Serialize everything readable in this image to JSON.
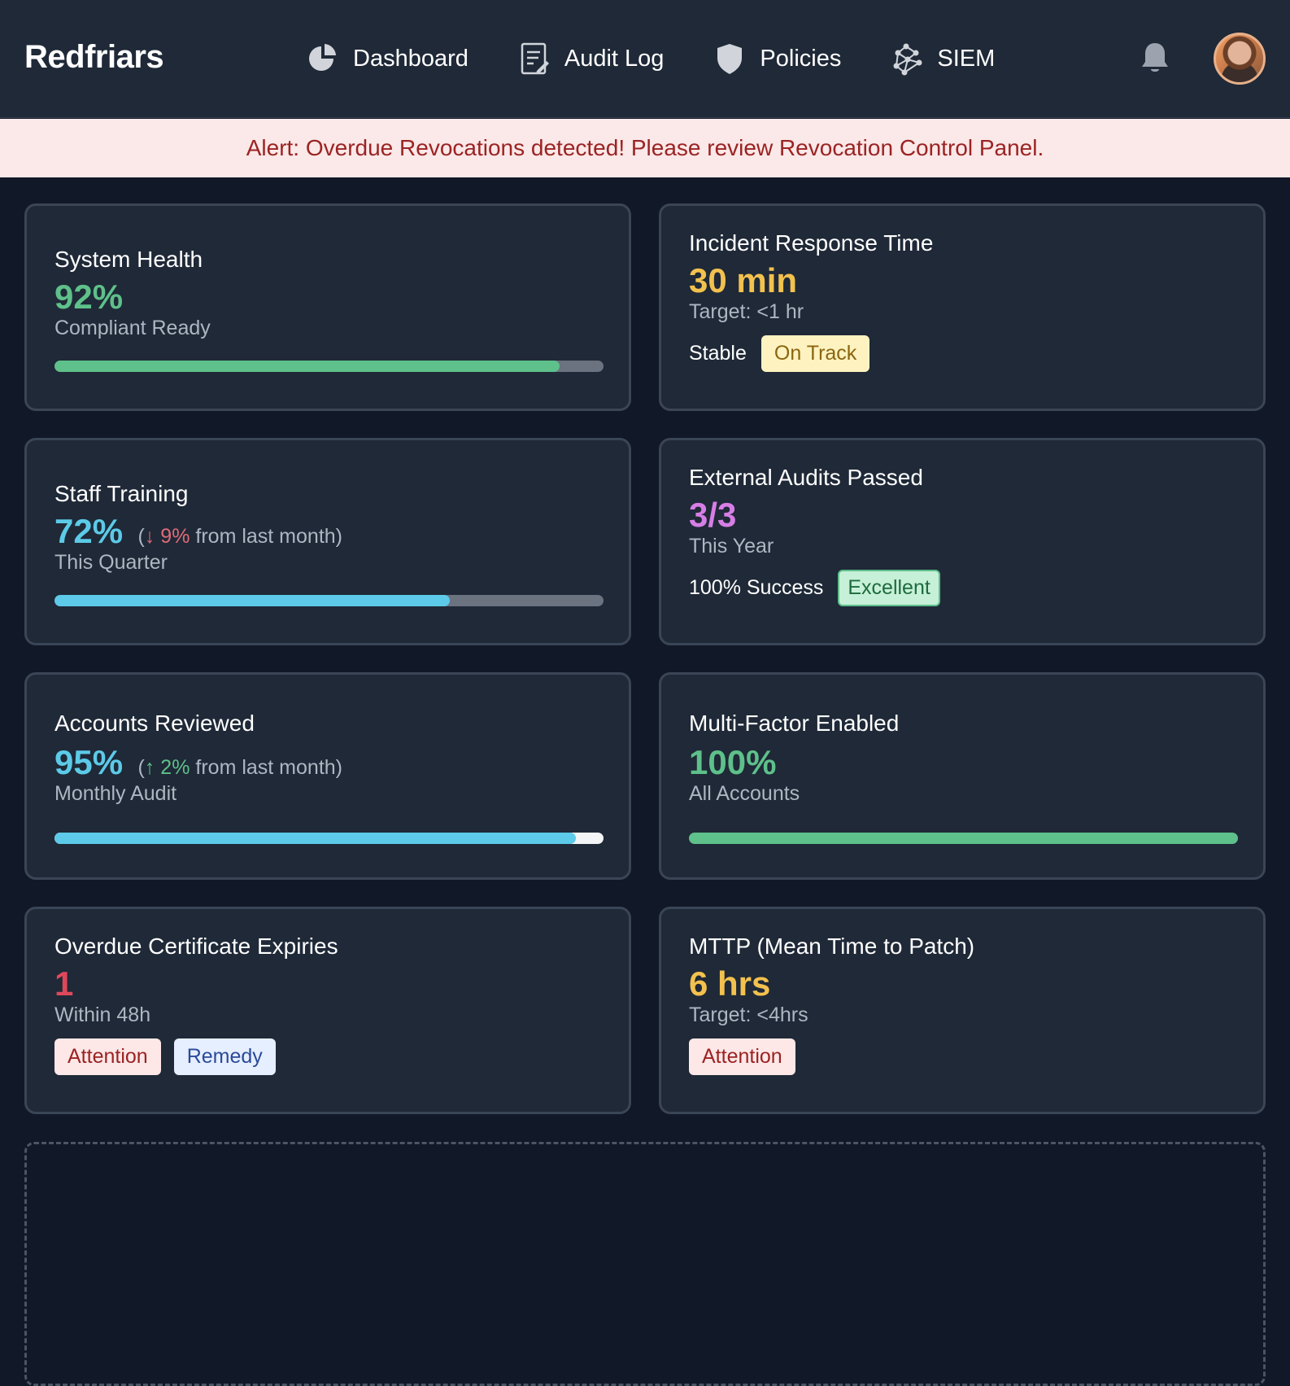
{
  "brand": "Redfriars",
  "nav": [
    {
      "label": "Dashboard",
      "icon": "pie-chart-icon"
    },
    {
      "label": "Audit Log",
      "icon": "document-icon"
    },
    {
      "label": "Policies",
      "icon": "shield-icon"
    },
    {
      "label": "SIEM",
      "icon": "network-icon"
    }
  ],
  "alert": "Alert: Overdue Revocations detected! Please review Revocation Control Panel.",
  "colors": {
    "green": "#5ec08a",
    "cyan": "#5ccae8",
    "amber": "#f2c14e",
    "purple": "#d77ee6",
    "red": "#e0485a"
  },
  "cards": {
    "system_health": {
      "title": "System Health",
      "value": "92%",
      "sub": "Compliant Ready",
      "progress": 0.92
    },
    "incident_response": {
      "title": "Incident Response Time",
      "value": "30 min",
      "sub": "Target: <1 hr",
      "status_label": "Stable",
      "badge": "On Track"
    },
    "staff_training": {
      "title": "Staff Training",
      "value": "72%",
      "delta_open": "(",
      "delta_arrow": "↓",
      "delta_value": "9%",
      "delta_text": "from last month)",
      "sub": "This Quarter",
      "progress": 0.72
    },
    "external_audits": {
      "title": "External Audits Passed",
      "value": "3/3",
      "sub": "This Year",
      "status_label": "100% Success",
      "badge": "Excellent"
    },
    "accounts_reviewed": {
      "title": "Accounts Reviewed",
      "value": "95%",
      "delta_open": "(",
      "delta_arrow": "↑",
      "delta_value": "2%",
      "delta_text": "from last month)",
      "sub": "Monthly Audit",
      "progress": 0.95
    },
    "mfa": {
      "title": "Multi-Factor Enabled",
      "value": "100%",
      "sub": "All Accounts",
      "progress": 1.0
    },
    "cert_expiries": {
      "title": "Overdue Certificate Expiries",
      "value": "1",
      "sub": "Within 48h",
      "badge_1": "Attention",
      "badge_2": "Remedy"
    },
    "mttp": {
      "title": "MTTP (Mean Time to Patch)",
      "value": "6 hrs",
      "sub": "Target: <4hrs",
      "badge": "Attention"
    }
  }
}
